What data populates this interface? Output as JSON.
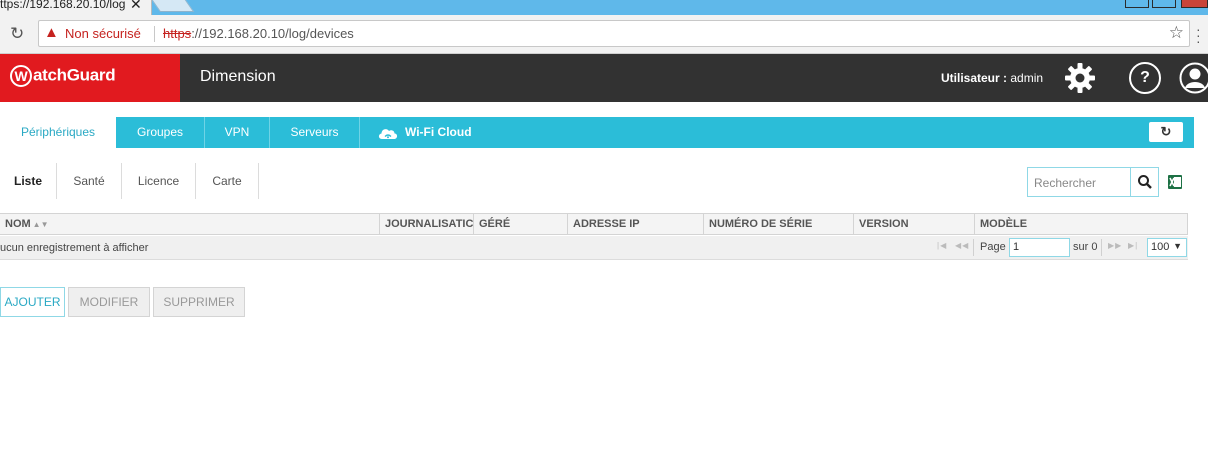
{
  "browser": {
    "tab_title": "ttps://192.168.20.10/log",
    "tab_close": "✕",
    "security_label": "Non sécurisé",
    "url_scheme": "https",
    "url_rest": "://192.168.20.10/log/devices"
  },
  "header": {
    "brand": "WatchGuard",
    "brand_mark": "W",
    "brand_rest": "atchGuard",
    "title": "Dimension",
    "user_prefix": "Utilisateur :",
    "user_name": "admin",
    "help": "?"
  },
  "main_tabs": [
    {
      "label": "Périphériques",
      "active": true
    },
    {
      "label": "Groupes",
      "active": false
    },
    {
      "label": "VPN",
      "active": false
    },
    {
      "label": "Serveurs",
      "active": false
    },
    {
      "label": "Wi-Fi Cloud",
      "active": false
    }
  ],
  "sub_tabs": [
    {
      "label": "Liste",
      "active": true
    },
    {
      "label": "Santé",
      "active": false
    },
    {
      "label": "Licence",
      "active": false
    },
    {
      "label": "Carte",
      "active": false
    }
  ],
  "search": {
    "placeholder": "Rechercher"
  },
  "grid": {
    "columns": [
      "NOM",
      "JOURNALISATIC",
      "GÉRÉ",
      "ADRESSE IP",
      "NUMÉRO DE SÉRIE",
      "VERSION",
      "MODÈLE"
    ],
    "empty_message": "ucun enregistrement à afficher",
    "page_label": "Page",
    "page_value": "1",
    "of_label": "sur 0",
    "page_size": "100"
  },
  "actions": {
    "add": "AJOUTER",
    "edit": "MODIFIER",
    "delete": "SUPPRIMER"
  },
  "colors": {
    "brand_red": "#e11a1f",
    "accent_teal": "#2bbdd8",
    "header_dark": "#323232"
  }
}
